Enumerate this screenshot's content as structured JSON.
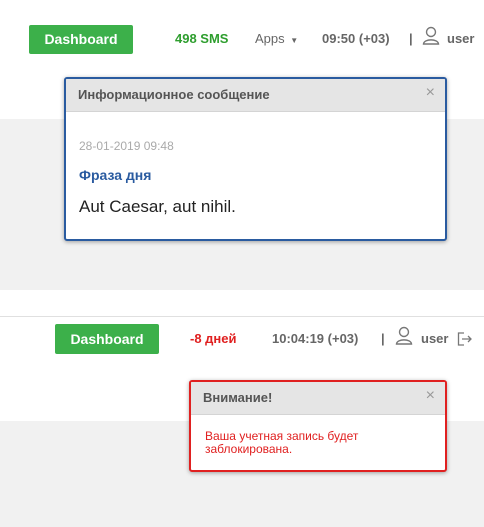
{
  "top": {
    "dashboard_label": "Dashboard",
    "sms": "498 SMS",
    "apps": "Apps",
    "time": "09:50 (+03)",
    "separator": "|",
    "user": "user",
    "modal": {
      "title": "Информационное сообщение",
      "close": "×",
      "date": "28-01-2019 09:48",
      "subject": "Фраза дня",
      "message": "Aut Caesar, aut nihil."
    }
  },
  "bottom": {
    "dashboard_label": "Dashboard",
    "days": "-8 дней",
    "time": "10:04:19 (+03)",
    "separator": "|",
    "user": "user",
    "modal": {
      "title": "Внимание!",
      "close": "×",
      "message": "Ваша учетная запись будет заблокирована."
    }
  },
  "colors": {
    "dashboard_green": "#3cb04a",
    "sms_green": "#2e9e2e",
    "warning_red": "#e02020",
    "info_border": "#2a5ba0",
    "alert_border": "#e02020"
  }
}
